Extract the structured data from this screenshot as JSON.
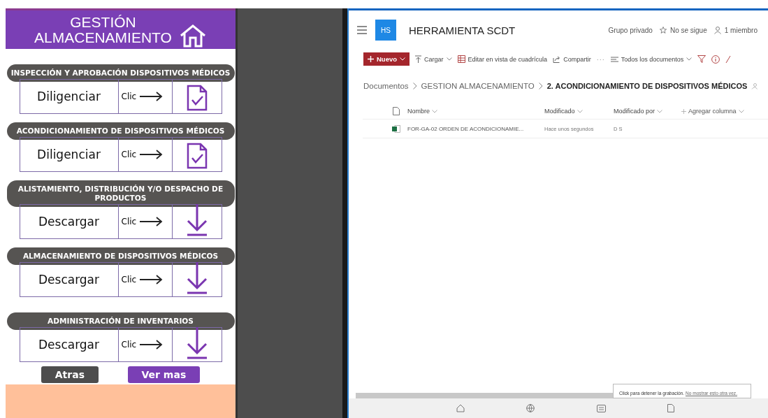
{
  "app": {
    "title_lines": [
      "GESTIÓN",
      "ALMACENAMIENTO"
    ],
    "sections": [
      {
        "title": "INSPECCIÓN Y APROBACIÓN DISPOSITIVOS MÉDICOS",
        "action": "Diligenciar",
        "click_label": "Clic",
        "kind": "form"
      },
      {
        "title": "ACONDICIONAMIENTO DE DISPOSITIVOS MÉDICOS",
        "action": "Diligenciar",
        "click_label": "Clic",
        "kind": "form"
      },
      {
        "title": "ALISTAMIENTO, DISTRIBUCIÓN Y/O DESPACHO DE PRODUCTOS",
        "action": "Descargar",
        "click_label": "Clic",
        "kind": "download"
      },
      {
        "title": "ALMACENAMIENTO DE DISPOSITIVOS MÉDICOS",
        "action": "Descargar",
        "click_label": "Clic",
        "kind": "download"
      },
      {
        "title": "ADMINISTRACIÓN DE INVENTARIOS",
        "action": "Descargar",
        "click_label": "Clic",
        "kind": "download"
      }
    ],
    "buttons": [
      {
        "label": "Atras",
        "kind": "secondary"
      },
      {
        "label": "Ver mas",
        "kind": "primary"
      }
    ]
  },
  "site": {
    "logo": "HS",
    "title": "HERRAMIENTA SCDT",
    "meta": [
      {
        "text": "Grupo privado",
        "kind": "plain"
      },
      {
        "text": "No se sigue",
        "kind": "star"
      },
      {
        "text": "1 miembro",
        "kind": "person"
      }
    ],
    "commands": [
      {
        "label": "Nuevo",
        "kind": "new"
      },
      {
        "label": "Cargar",
        "kind": "upload"
      },
      {
        "label": "Editar en vista de cuadrícula",
        "kind": "grid"
      },
      {
        "label": "Compartir",
        "kind": "share"
      },
      {
        "label": "···",
        "kind": "more"
      },
      {
        "label": "Todos los documentos",
        "kind": "view"
      }
    ],
    "breadcrumb": [
      {
        "text": "Documentos",
        "current": false
      },
      {
        "text": "GESTION ALMACENAMIENTO",
        "current": false
      },
      {
        "text": "2. ACONDICIONAMIENTO DE DISPOSITIVOS MÉDICOS",
        "current": true
      }
    ],
    "columns": [
      "Nombre",
      "Modificado",
      "Modificado por",
      "Agregar columna"
    ],
    "rows": [
      {
        "name": "FOR-GA-02 ORDEN DE ACONDICIONAMIE...",
        "modified": "Hace unos segundos",
        "modified_by": "D S"
      }
    ],
    "tooltip": {
      "text": "Click para detener la grabación.",
      "link": "No mostrar esto otra vez."
    }
  }
}
